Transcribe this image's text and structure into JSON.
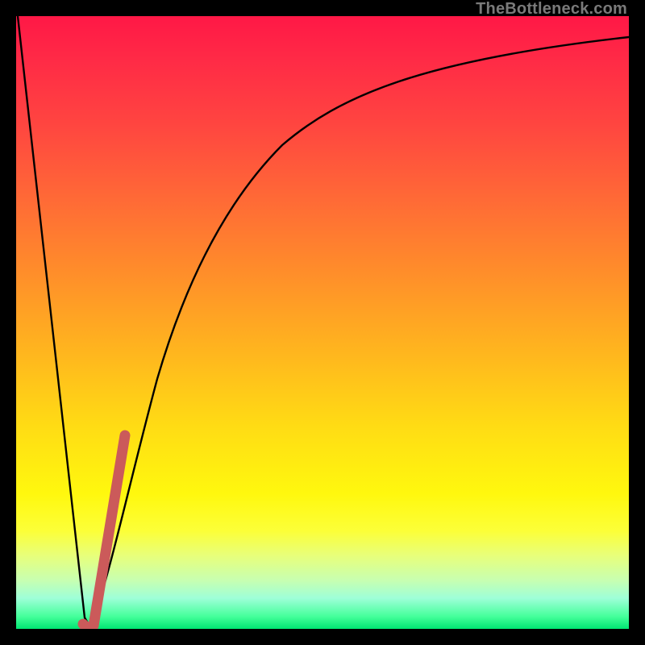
{
  "watermark": "TheBottleneck.com",
  "colors": {
    "frame": "#000000",
    "gradient_top": "#ff1846",
    "gradient_mid": "#ffdc14",
    "gradient_bottom": "#00e572",
    "curve": "#000000",
    "highlight": "#cb5a5a"
  },
  "chart_data": {
    "type": "line",
    "title": "",
    "xlabel": "",
    "ylabel": "",
    "xlim": [
      0,
      100
    ],
    "ylim": [
      0,
      100
    ],
    "grid": false,
    "series": [
      {
        "name": "main-curve",
        "x": [
          0,
          5,
          10,
          11,
          12,
          15,
          18,
          22,
          28,
          35,
          45,
          60,
          80,
          100
        ],
        "y": [
          100,
          55,
          10,
          0,
          4,
          20,
          35,
          50,
          65,
          76,
          85,
          91,
          95,
          97
        ]
      },
      {
        "name": "highlight-segment",
        "x": [
          11,
          12.5,
          14,
          15.5,
          17
        ],
        "y": [
          0,
          8,
          16,
          24,
          32
        ]
      }
    ],
    "annotations": []
  }
}
